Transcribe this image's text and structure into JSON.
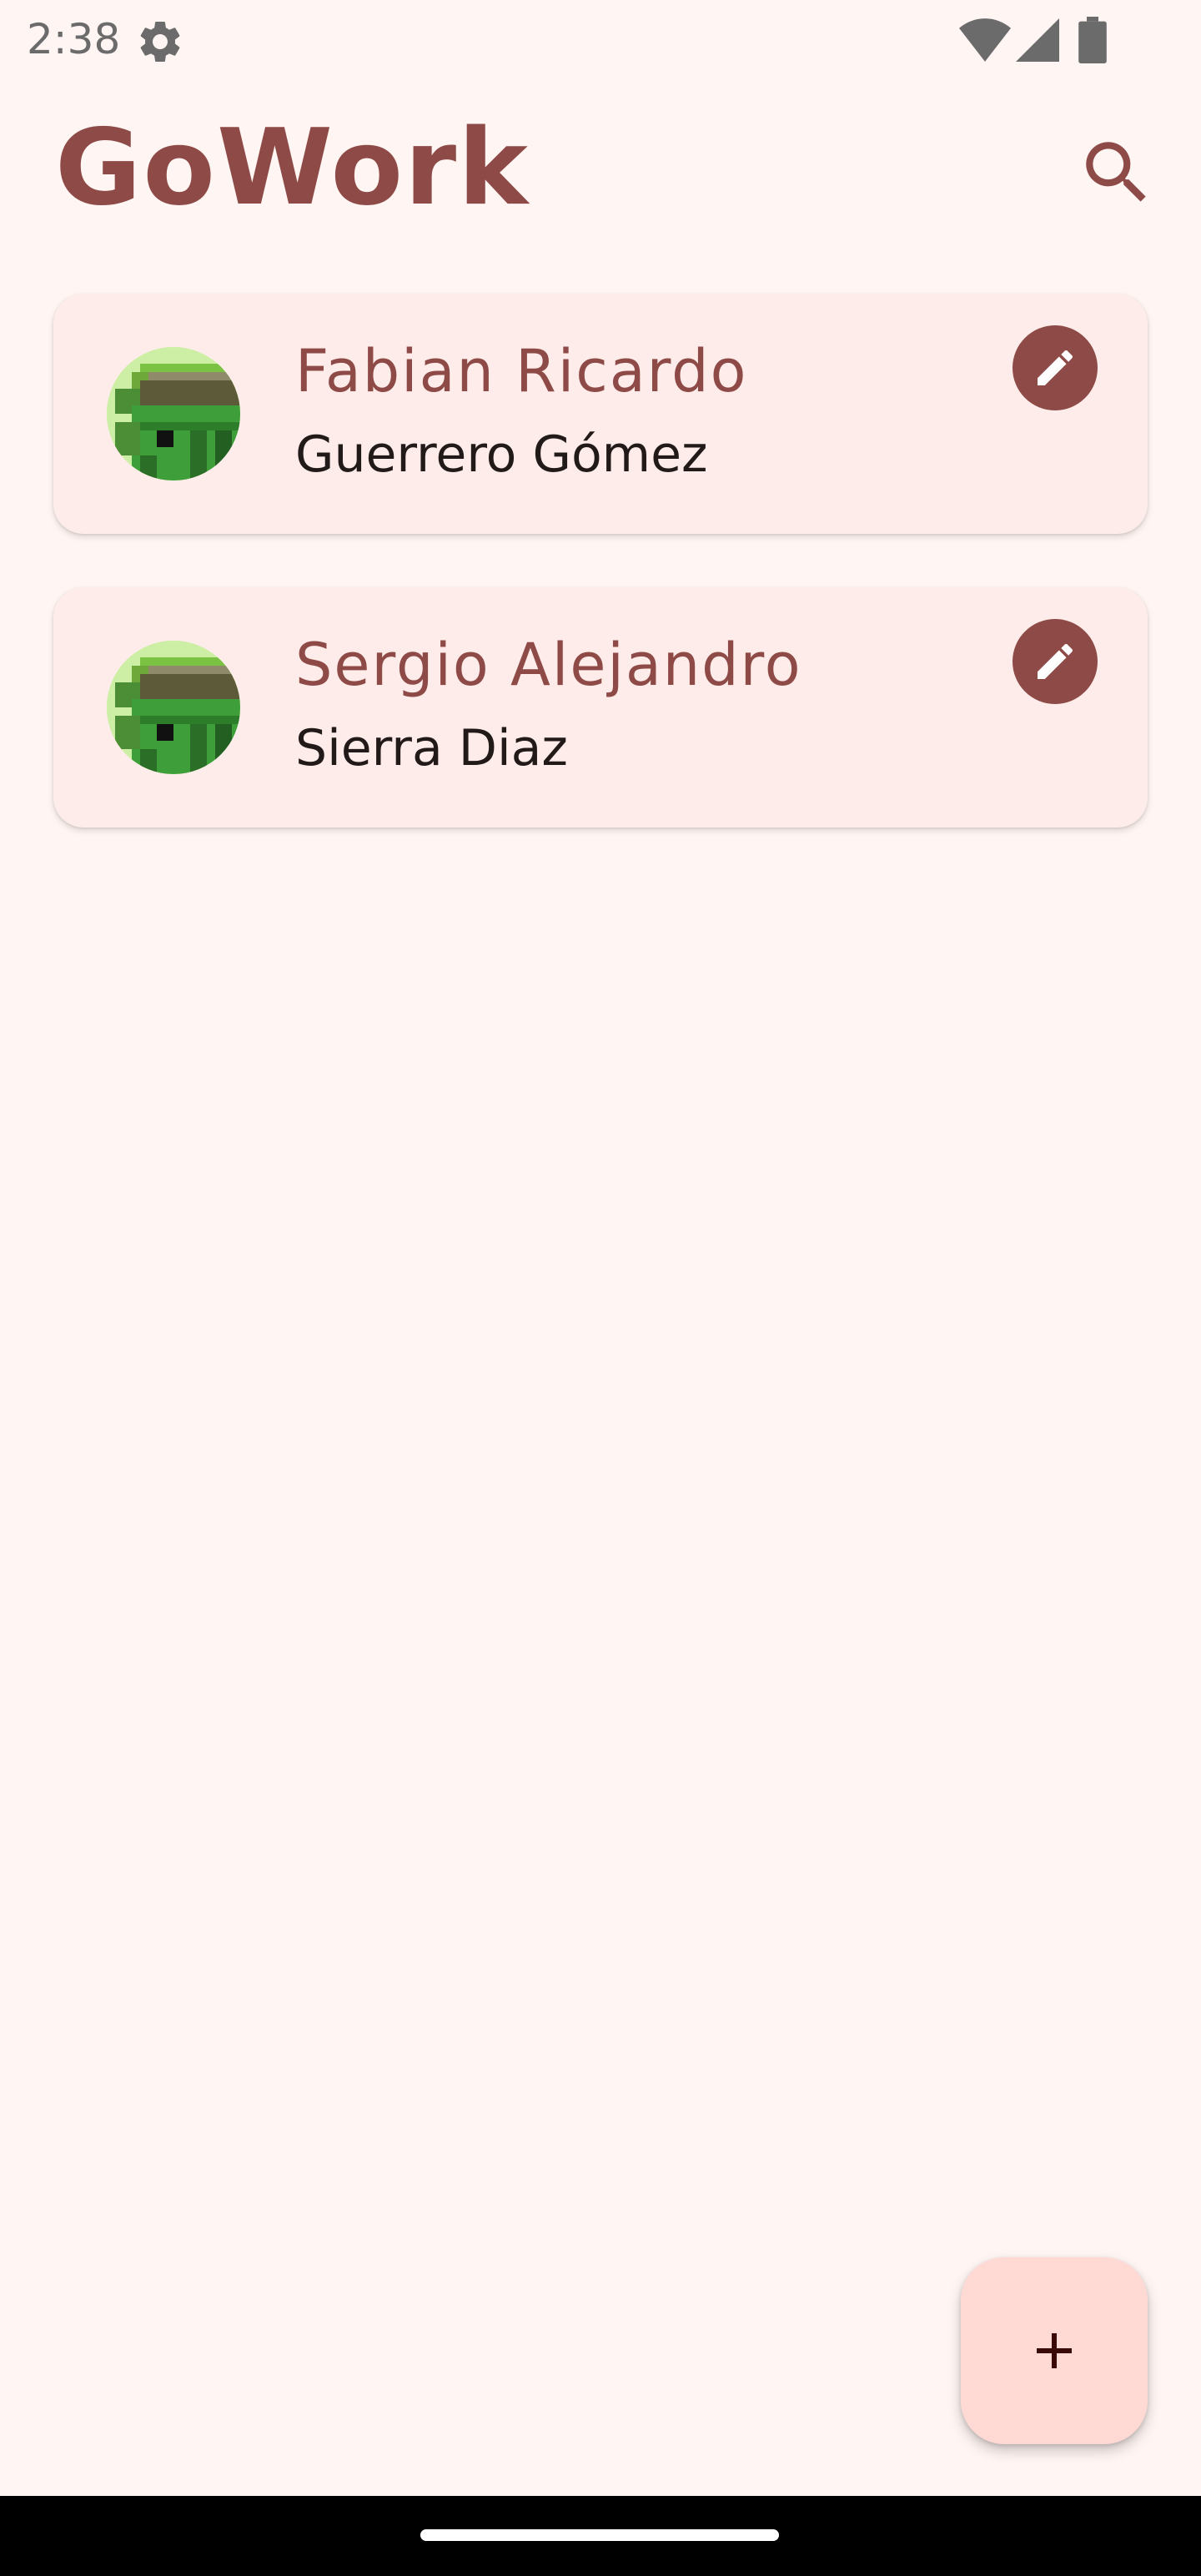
{
  "status_bar": {
    "time": "2:38",
    "icons": [
      "settings-gear-icon",
      "wifi-icon",
      "cellular-signal-icon",
      "battery-icon"
    ]
  },
  "app_bar": {
    "title": "GoWork",
    "search_icon": "search-icon"
  },
  "workers": [
    {
      "first_name": "Fabian Ricardo",
      "last_name": "Guerrero Gómez",
      "edit_icon": "pencil-icon"
    },
    {
      "first_name": "Sergio Alejandro",
      "last_name": "Sierra Diaz",
      "edit_icon": "pencil-icon"
    }
  ],
  "fab": {
    "icon": "plus-icon"
  },
  "colors": {
    "primary": "#8E4A46",
    "background": "#FFF5F3",
    "card": "#FDECE9",
    "fab": "#FFDAD5",
    "text": "#221A19"
  }
}
